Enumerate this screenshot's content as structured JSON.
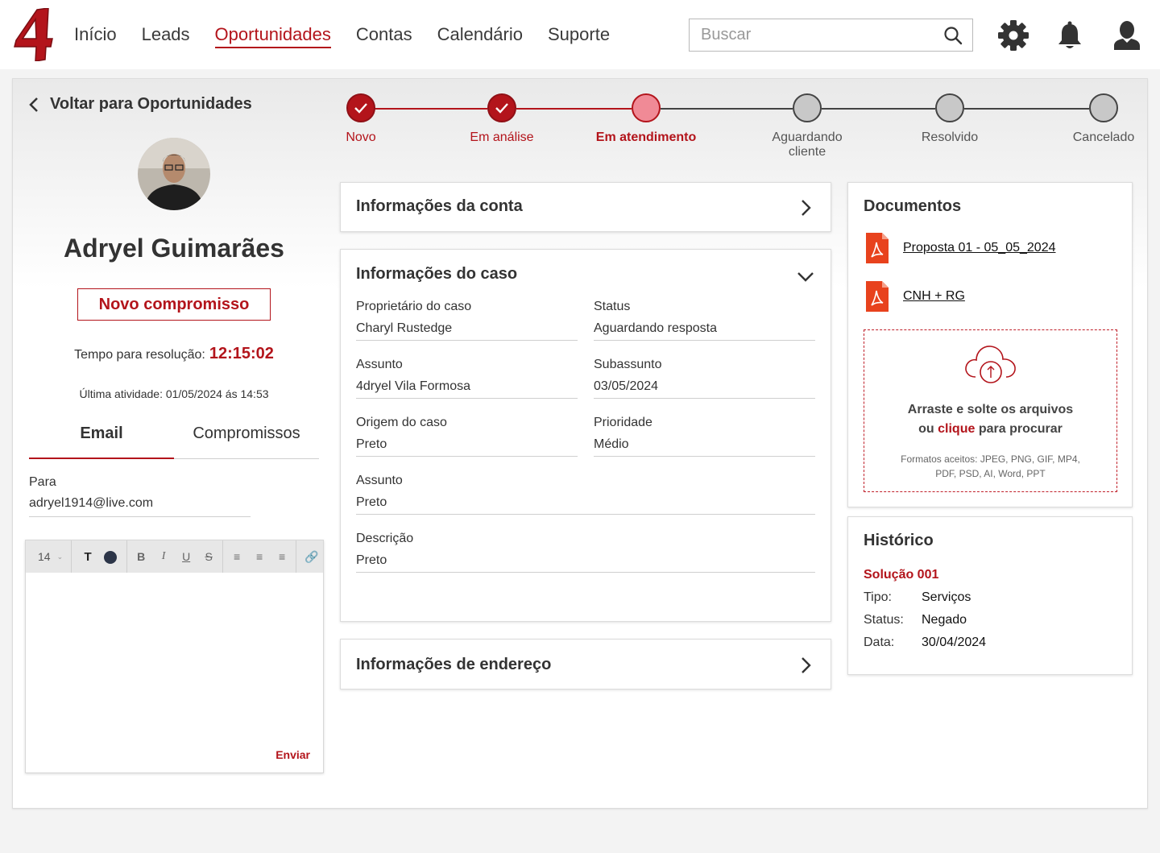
{
  "nav": {
    "items": [
      "Início",
      "Leads",
      "Oportunidades",
      "Contas",
      "Calendário",
      "Suporte"
    ],
    "active": "Oportunidades"
  },
  "search": {
    "placeholder": "Buscar"
  },
  "icons": {
    "settings": "gear-icon",
    "notifications": "bell-icon",
    "profile": "user-icon",
    "search": "search-icon"
  },
  "colors": {
    "brand": "#b3141b",
    "step_current": "#f08a96",
    "step_todo": "#c8c8c8"
  },
  "left": {
    "back_label": "Voltar para Oportunidades",
    "person_name": "Adryel Guimarães",
    "new_commitment": "Novo compromisso",
    "timer_label": "Tempo para resolução:",
    "timer_value": "12:15:02",
    "last_activity": "Última atividade: 01/05/2024 ás 14:53",
    "tabs": [
      "Email",
      "Compromissos"
    ],
    "to_label": "Para",
    "to_value": "adryel1914@live.com",
    "font_size": "14",
    "send_label": "Enviar"
  },
  "stepper": {
    "steps": [
      {
        "label": "Novo",
        "state": "done"
      },
      {
        "label": "Em análise",
        "state": "done"
      },
      {
        "label": "Em atendimento",
        "state": "current"
      },
      {
        "label": "Aguardando cliente",
        "state": "todo"
      },
      {
        "label": "Resolvido",
        "state": "todo"
      },
      {
        "label": "Cancelado",
        "state": "todo"
      }
    ]
  },
  "account_info": {
    "title": "Informações da conta"
  },
  "case_info": {
    "title": "Informações do caso",
    "fields": [
      {
        "label": "Proprietário do caso",
        "value": "Charyl Rustedge"
      },
      {
        "label": "Status",
        "value": "Aguardando resposta"
      },
      {
        "label": "Assunto",
        "value": "4dryel Vila Formosa"
      },
      {
        "label": "Subassunto",
        "value": "03/05/2024"
      },
      {
        "label": "Origem do caso",
        "value": "Preto"
      },
      {
        "label": "Prioridade",
        "value": "Médio"
      },
      {
        "label": "Assunto",
        "value": "Preto"
      },
      {
        "label": "Descrição",
        "value": "Preto"
      }
    ]
  },
  "address_info": {
    "title": "Informações de endereço"
  },
  "documents": {
    "title": "Documentos",
    "files": [
      "Proposta 01 - 05_05_2024",
      "CNH + RG"
    ],
    "dropzone_line1": "Arraste e solte os arquivos",
    "dropzone_pre": "ou ",
    "dropzone_link": "clique",
    "dropzone_post": " para procurar",
    "formats_line1": "Formatos aceitos: JPEG, PNG, GIF, MP4,",
    "formats_line2": "PDF, PSD, AI, Word, PPT"
  },
  "history": {
    "title": "Histórico",
    "entry_title": "Solução 001",
    "rows": [
      {
        "key": "Tipo:",
        "value": "Serviços"
      },
      {
        "key": "Status:",
        "value": "Negado"
      },
      {
        "key": "Data:",
        "value": "30/04/2024"
      }
    ]
  }
}
